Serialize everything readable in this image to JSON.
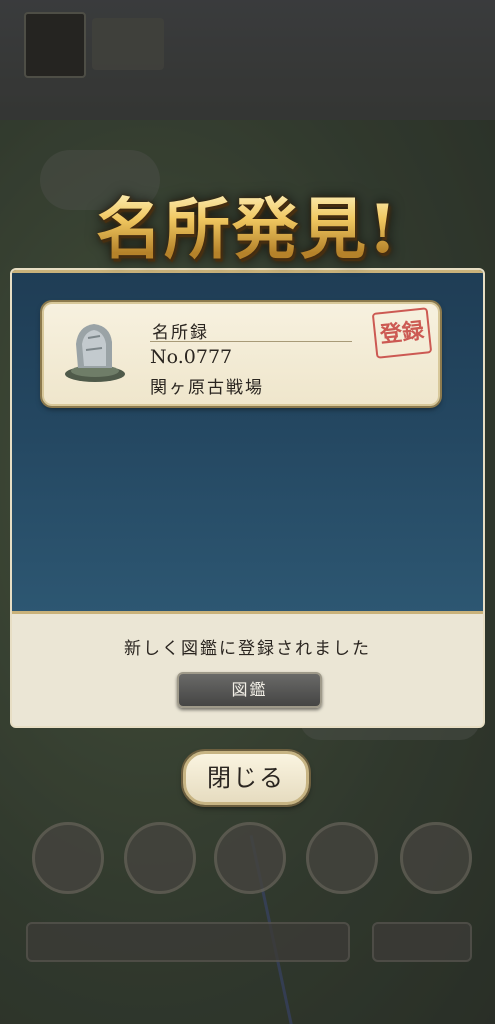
{
  "popup": {
    "title": "名所発見!",
    "card": {
      "category": "名所録",
      "number": "No.0777",
      "name": "関ヶ原古戦場",
      "stamp": "登録",
      "icon": "stone-monument-icon"
    },
    "message": "新しく図鑑に登録されました",
    "zukan_button": "図鑑",
    "close_button": "閉じる"
  },
  "colors": {
    "title_gold": "#f0c760",
    "panel_blue": "#244761",
    "stamp_red": "#c84a45",
    "card_bg": "#f7f1df"
  }
}
